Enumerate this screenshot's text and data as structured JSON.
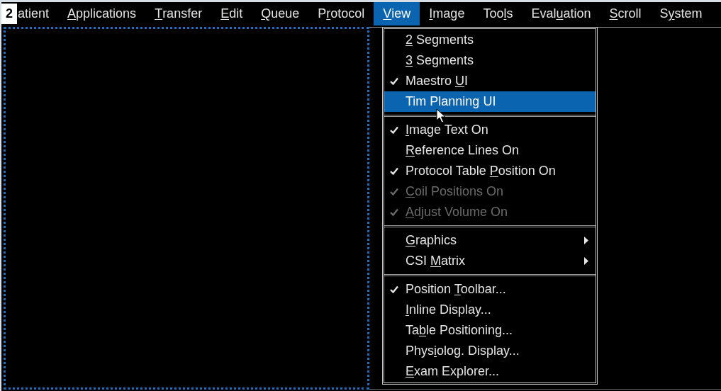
{
  "menu_bar": {
    "badge": "2",
    "items": [
      {
        "before": "atient",
        "selected": false
      },
      {
        "key": "A",
        "after": "pplications",
        "selected": false
      },
      {
        "key": "T",
        "after": "ransfer",
        "selected": false
      },
      {
        "key": "E",
        "after": "dit",
        "selected": false
      },
      {
        "key": "Q",
        "after": "ueue",
        "selected": false
      },
      {
        "before": "P",
        "key": "r",
        "after": "otocol",
        "selected": false
      },
      {
        "key": "V",
        "after": "iew",
        "selected": true
      },
      {
        "key": "I",
        "after": "mage",
        "selected": false
      },
      {
        "before": "Too",
        "key": "l",
        "after": "s",
        "selected": false
      },
      {
        "before": "Eval",
        "key": "u",
        "after": "ation",
        "selected": false
      },
      {
        "key": "S",
        "after": "croll",
        "selected": false
      },
      {
        "before": "S",
        "key": "y",
        "after": "stem",
        "selected": false
      }
    ]
  },
  "dropdown": {
    "groups": [
      [
        {
          "key": "2",
          "after": " Segments",
          "checked": false,
          "disabled": false,
          "selected": false,
          "submenu": false
        },
        {
          "key": "3",
          "after": " Segments",
          "checked": false,
          "disabled": false,
          "selected": false,
          "submenu": false
        },
        {
          "before": "Maestro ",
          "key": "U",
          "after": "I",
          "checked": true,
          "disabled": false,
          "selected": false,
          "submenu": false
        },
        {
          "before": "Tim Planning UI",
          "checked": false,
          "disabled": false,
          "selected": true,
          "submenu": false
        }
      ],
      [
        {
          "key": "I",
          "after": "mage Text On",
          "checked": true,
          "disabled": false,
          "selected": false,
          "submenu": false
        },
        {
          "key": "R",
          "after": "eference Lines On",
          "checked": false,
          "disabled": false,
          "selected": false,
          "submenu": false
        },
        {
          "before": "Protocol Table ",
          "key": "P",
          "after": "osition On",
          "checked": true,
          "disabled": false,
          "selected": false,
          "submenu": false
        },
        {
          "key": "C",
          "after": "oil Positions On",
          "checked": true,
          "disabled": true,
          "selected": false,
          "submenu": false
        },
        {
          "key": "A",
          "after": "djust Volume On",
          "checked": true,
          "disabled": true,
          "selected": false,
          "submenu": false
        }
      ],
      [
        {
          "key": "G",
          "after": "raphics",
          "checked": false,
          "disabled": false,
          "selected": false,
          "submenu": true
        },
        {
          "before": "CSI ",
          "key": "M",
          "after": "atrix",
          "checked": false,
          "disabled": false,
          "selected": false,
          "submenu": true
        }
      ],
      [
        {
          "before": "Position ",
          "key": "T",
          "after": "oolbar...",
          "checked": true,
          "disabled": false,
          "selected": false,
          "submenu": false
        },
        {
          "key": "I",
          "after": "nline Display...",
          "checked": false,
          "disabled": false,
          "selected": false,
          "submenu": false
        },
        {
          "before": "Ta",
          "key": "b",
          "after": "le Positioning...",
          "checked": false,
          "disabled": false,
          "selected": false,
          "submenu": false
        },
        {
          "before": "Phys",
          "key": "i",
          "after": "olog. Display...",
          "checked": false,
          "disabled": false,
          "selected": false,
          "submenu": false
        },
        {
          "key": "E",
          "after": "xam Explorer...",
          "checked": false,
          "disabled": false,
          "selected": false,
          "submenu": false
        }
      ]
    ]
  }
}
